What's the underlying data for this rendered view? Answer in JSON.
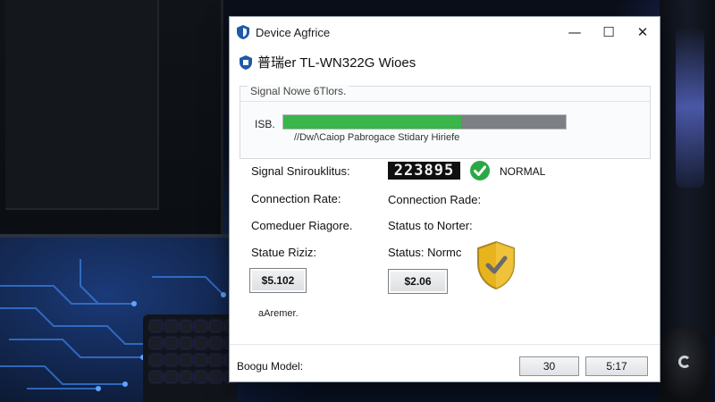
{
  "window": {
    "title": "Device Agfrice",
    "controls": {
      "minimize": "—",
      "maximize": "☐",
      "close": "✕"
    }
  },
  "header": {
    "title": "普瑞er TL-WN322G Wioes"
  },
  "signal_panel": {
    "title": "Signal Nowe 6Tlors.",
    "bar_label": "ISB.",
    "bar_fill_fraction": 0.63,
    "bar_caption": "//Dw/\\Caiop Pabrogace Stidary Hiriefe",
    "fill_color": "#39b54a"
  },
  "status": {
    "signal_label": "Signal Snirouklitus:",
    "signal_value": "223895",
    "signal_status": "NORMAL",
    "connection_rate_label": "Connection Rate:",
    "connection_rade_label": "Connection Rade:",
    "comeduer_label": "Comeduer Riagore.",
    "status_to_label": "Status to  Norter:",
    "statue_label": "Statue Riziz:",
    "status_normc_label": "Status: Normc",
    "value_box_left": "$5.102",
    "value_box_right": "$2.06",
    "note": "aAremer."
  },
  "footer": {
    "model_label": "Boogu Model:",
    "button_left": "30",
    "button_right": "5:17"
  },
  "icons": {
    "app": "shield-icon",
    "device": "device-shield-icon",
    "status_ok": "check-circle-icon",
    "security": "security-shield-icon"
  },
  "colors": {
    "accent_blue": "#1e5aa8",
    "ok_green": "#2aa844",
    "shield_gold": "#e7b41e"
  }
}
